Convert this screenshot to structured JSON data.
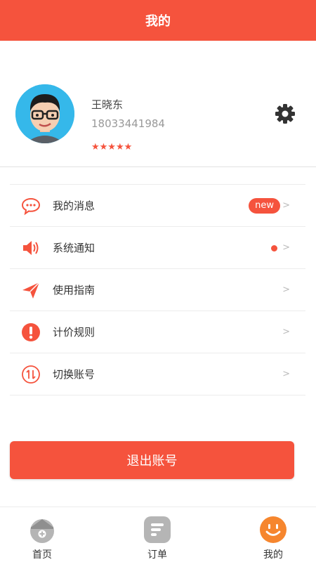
{
  "header": {
    "title": "我的"
  },
  "profile": {
    "name": "王晓东",
    "phone": "18033441984",
    "rating_text": "★★★★★",
    "rating": 5,
    "avatar_icon": "avatar-cartoon-man-icon",
    "settings_icon": "gear-icon"
  },
  "menu": {
    "items": [
      {
        "label": "我的消息",
        "icon": "chat-bubble-icon",
        "badge": "new",
        "arrow": ">"
      },
      {
        "label": "系统通知",
        "icon": "speaker-icon",
        "arrow": ">"
      },
      {
        "label": "使用指南",
        "icon": "paper-plane-icon",
        "arrow": ">"
      },
      {
        "label": "计价规则",
        "icon": "exclamation-icon",
        "arrow": ">"
      },
      {
        "label": "切换账号",
        "icon": "switch-arrows-icon",
        "arrow": ">"
      }
    ]
  },
  "logout": {
    "label": "退出账号"
  },
  "tabbar": {
    "tabs": [
      {
        "label": "首页",
        "icon": "home-icon",
        "active": false
      },
      {
        "label": "订单",
        "icon": "orders-icon",
        "active": false
      },
      {
        "label": "我的",
        "icon": "smile-icon",
        "active": true
      }
    ]
  },
  "colors": {
    "accent": "#f5533d",
    "tab_active": "#f6862e",
    "tab_inactive": "#b5b5b5"
  }
}
